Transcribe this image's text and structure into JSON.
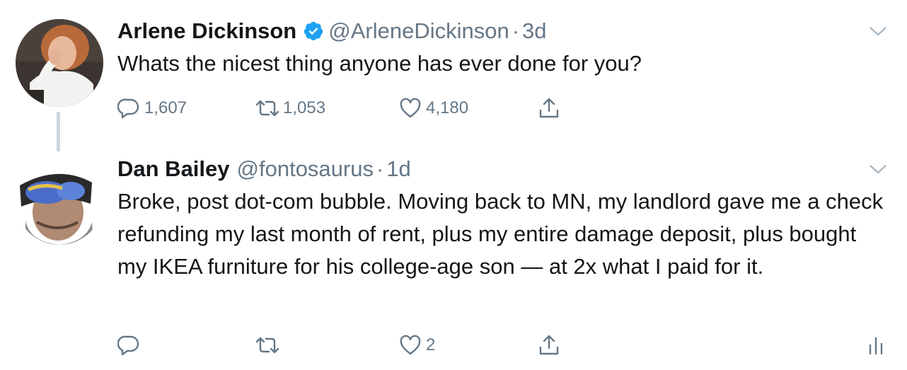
{
  "tweets": [
    {
      "name": "Arlene Dickinson",
      "verified": true,
      "handle": "@ArleneDickinson",
      "separator": "·",
      "time": "3d",
      "text": "Whats the nicest thing anyone has ever done for you?",
      "replies": "1,607",
      "retweets": "1,053",
      "likes": "4,180"
    },
    {
      "name": "Dan Bailey",
      "verified": false,
      "handle": "@fontosaurus",
      "separator": "·",
      "time": "1d",
      "text": "Broke, post dot-com bubble. Moving back to MN, my landlord gave me a check refunding my last month of rent, plus my entire damage deposit, plus bought my IKEA furniture for his college-age son  — at 2x what I paid for it.",
      "replies": "",
      "retweets": "",
      "likes": "2"
    }
  ],
  "colors": {
    "text": "#14171a",
    "secondary": "#657786",
    "verified": "#1da1f2",
    "thread_line": "#ccd6dd"
  },
  "icons": [
    "reply-icon",
    "retweet-icon",
    "like-icon",
    "share-icon",
    "caret-down-icon",
    "verified-badge-icon",
    "analytics-icon"
  ]
}
